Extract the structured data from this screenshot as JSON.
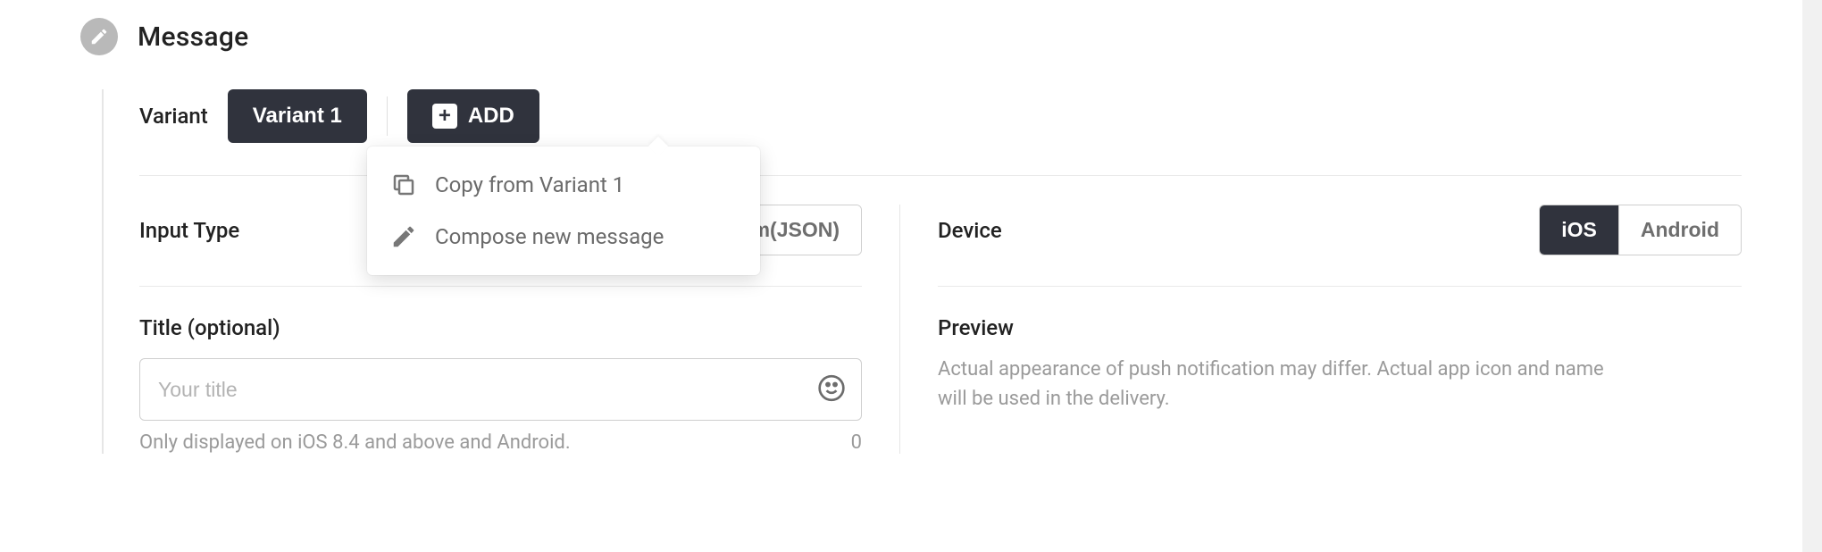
{
  "header": {
    "title": "Message"
  },
  "variant": {
    "label": "Variant",
    "active_tab": "Variant 1",
    "add_label": "ADD",
    "menu": {
      "copy": "Copy from Variant 1",
      "compose": "Compose new message"
    }
  },
  "input_type": {
    "label": "Input Type",
    "options": {
      "custom_json": "Custom(JSON)"
    }
  },
  "device": {
    "label": "Device",
    "options": {
      "ios": "iOS",
      "android": "Android"
    }
  },
  "title_field": {
    "label": "Title (optional)",
    "placeholder": "Your title",
    "value": "",
    "help": "Only displayed on iOS 8.4 and above and Android.",
    "count": "0"
  },
  "preview": {
    "label": "Preview",
    "desc": "Actual appearance of push notification may differ. Actual app icon and name will be used in the delivery."
  }
}
